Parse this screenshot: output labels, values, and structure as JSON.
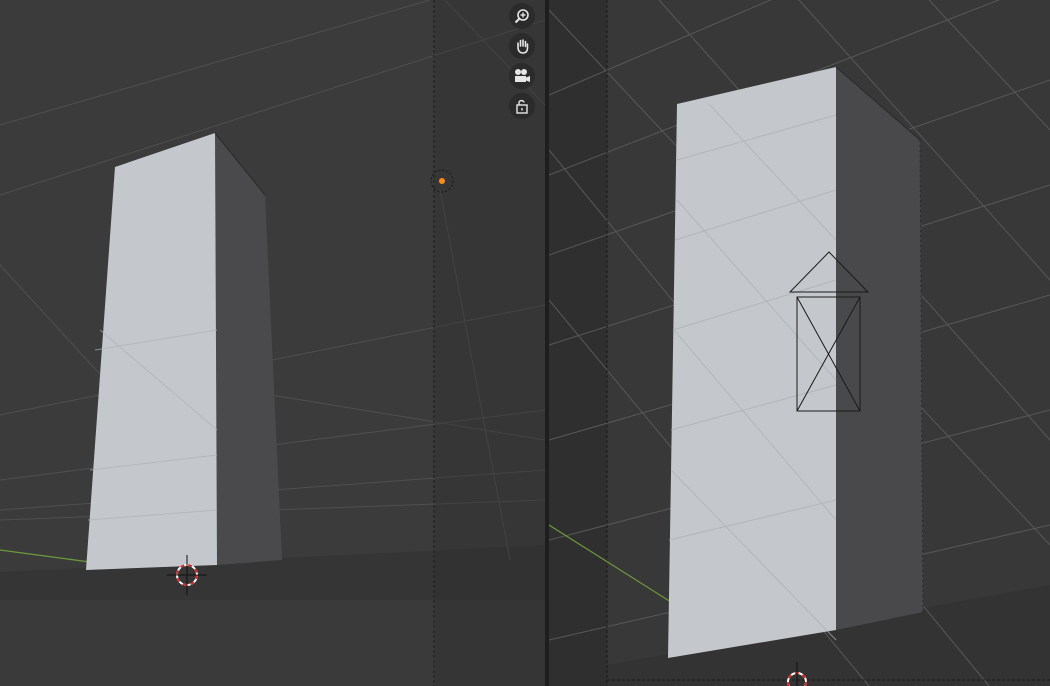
{
  "editor": {
    "viewports": [
      {
        "id": "left",
        "kind": "3D Viewport",
        "view": "perspective"
      },
      {
        "id": "right",
        "kind": "3D Viewport",
        "view": "camera"
      }
    ],
    "navigation_gizmo": [
      {
        "name": "zoom",
        "icon": "zoom-in-icon"
      },
      {
        "name": "pan",
        "icon": "hand-icon"
      },
      {
        "name": "camera",
        "icon": "camera-icon"
      },
      {
        "name": "lock",
        "icon": "unlock-icon"
      }
    ]
  },
  "colors": {
    "background": "#3a3a3a",
    "floor": "#323232",
    "box_front": "#c4c8cc",
    "box_side": "#4a4a4c",
    "grid": "#555555",
    "y_axis": "#6b9a3a",
    "light_origin": "#ff8c1a",
    "cursor_red": "#d42a2a"
  }
}
